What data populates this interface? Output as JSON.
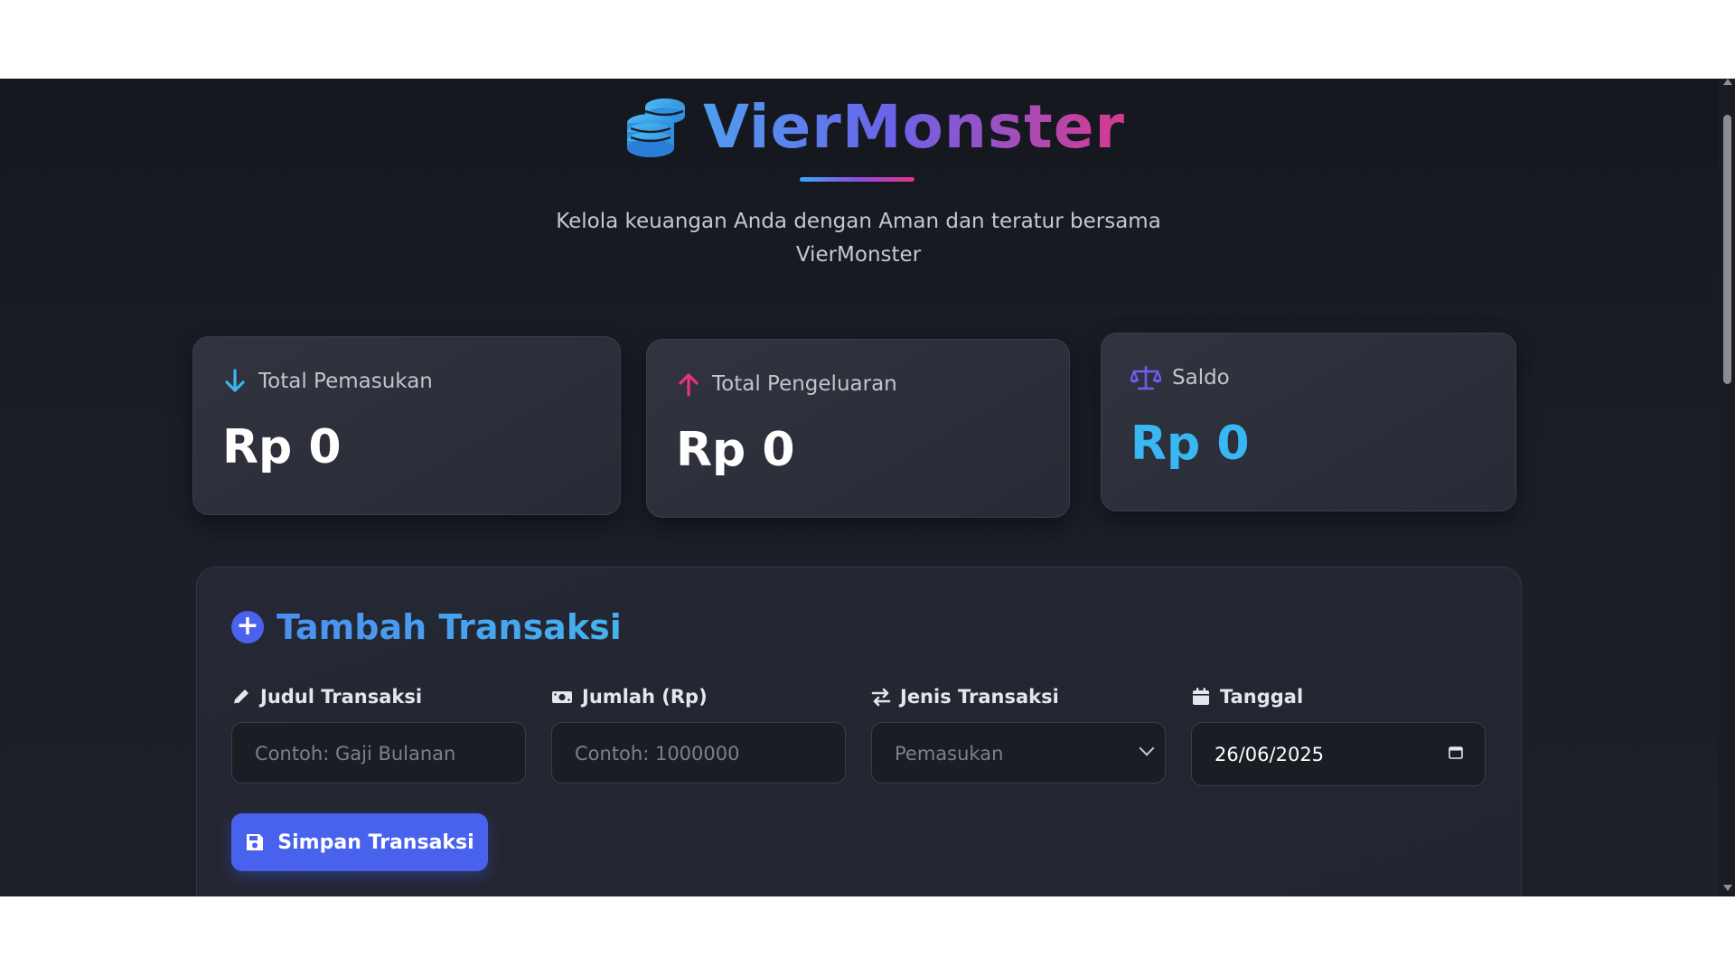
{
  "header": {
    "brand_name": "VierMonster",
    "logo_icon": "coins-stack-icon",
    "tagline_line1": "Kelola keuangan Anda dengan Aman dan teratur bersama",
    "tagline_line2": "VierMonster"
  },
  "summary": {
    "income": {
      "icon": "arrow-down-icon",
      "label": "Total Pemasukan",
      "value": "Rp 0",
      "accent": "#38b7f2"
    },
    "expense": {
      "icon": "arrow-up-icon",
      "label": "Total Pengeluaran",
      "value": "Rp 0",
      "accent": "#e8347f"
    },
    "balance": {
      "icon": "scale-balance-icon",
      "label": "Saldo",
      "value": "Rp 0",
      "accent": "#38b7f2"
    }
  },
  "form": {
    "title": "Tambah Transaksi",
    "title_icon": "plus-circle-icon",
    "fields": {
      "title": {
        "icon": "pencil-icon",
        "label": "Judul Transaksi",
        "placeholder": "Contoh: Gaji Bulanan"
      },
      "amount": {
        "icon": "money-bill-icon",
        "label": "Jumlah (Rp)",
        "placeholder": "Contoh: 1000000"
      },
      "type": {
        "icon": "exchange-arrows-icon",
        "label": "Jenis Transaksi",
        "selected": "Pemasukan"
      },
      "date": {
        "icon": "calendar-icon",
        "label": "Tanggal",
        "value": "26/06/2025"
      }
    },
    "submit": {
      "icon": "floppy-disk-icon",
      "label": "Simpan Transaksi"
    }
  },
  "colors": {
    "primary_button": "#4862ee",
    "background": "#1b1e27",
    "card": "#2c2f3a"
  }
}
